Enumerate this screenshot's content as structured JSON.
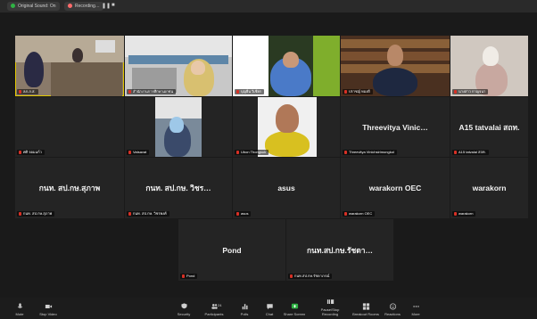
{
  "tabs": [
    {
      "label": "Original Sound: On",
      "dot_color": "#2fb344"
    },
    {
      "label": "Recording…",
      "dot_color": "#ff6b6b"
    }
  ],
  "participants_video": [
    {
      "label": "ลภ.ภ.ส."
    },
    {
      "label": "สำนักงานการศึกษาเอกชน"
    },
    {
      "label": "บุญยืน วิเชียร"
    },
    {
      "label": "ปราชญ์ ทองดี"
    },
    {
      "label": "นางสาว กาญจนา"
    },
    {
      "label": "Vatsavat"
    },
    {
      "label": "Ubon Thongsuk"
    }
  ],
  "participants_name": [
    {
      "name": "",
      "label": "ศศิ จอมแก้ว"
    },
    {
      "name": "Threevitya Vinic…",
      "label": "Threevitya Vinichsirimongkol"
    },
    {
      "name": "A15 tatvalai สถท.",
      "label": "A15 tatvalai สถท."
    },
    {
      "name": "กนท. สป.กษ.สุภาพ",
      "label": "กนท. สป.กษ.สุภาพ"
    },
    {
      "name": "กนท. สป.กษ. วิชร…",
      "label": "กนท. สป.กษ. วิชรพงศ์"
    },
    {
      "name": "asus",
      "label": "asus"
    },
    {
      "name": "warakorn OEC",
      "label": "warakorn OEC"
    },
    {
      "name": "warakorn",
      "label": "warakorn"
    },
    {
      "name": "Pond",
      "label": "Pond"
    },
    {
      "name": "กนท.สป.กษ.รัชดา…",
      "label": "กนท.สป.กษ.รัชดาภรณ์"
    }
  ],
  "toolbar": {
    "mute": "Mute",
    "stop_video": "Stop Video",
    "security": "Security",
    "participants": "Participants",
    "participants_count": "24",
    "polls": "Polls",
    "chat": "Chat",
    "share_screen": "Share Screen",
    "recording": "Pause/Stop Recording",
    "breakout": "Breakout Rooms",
    "reactions": "Reactions",
    "more": "More"
  }
}
